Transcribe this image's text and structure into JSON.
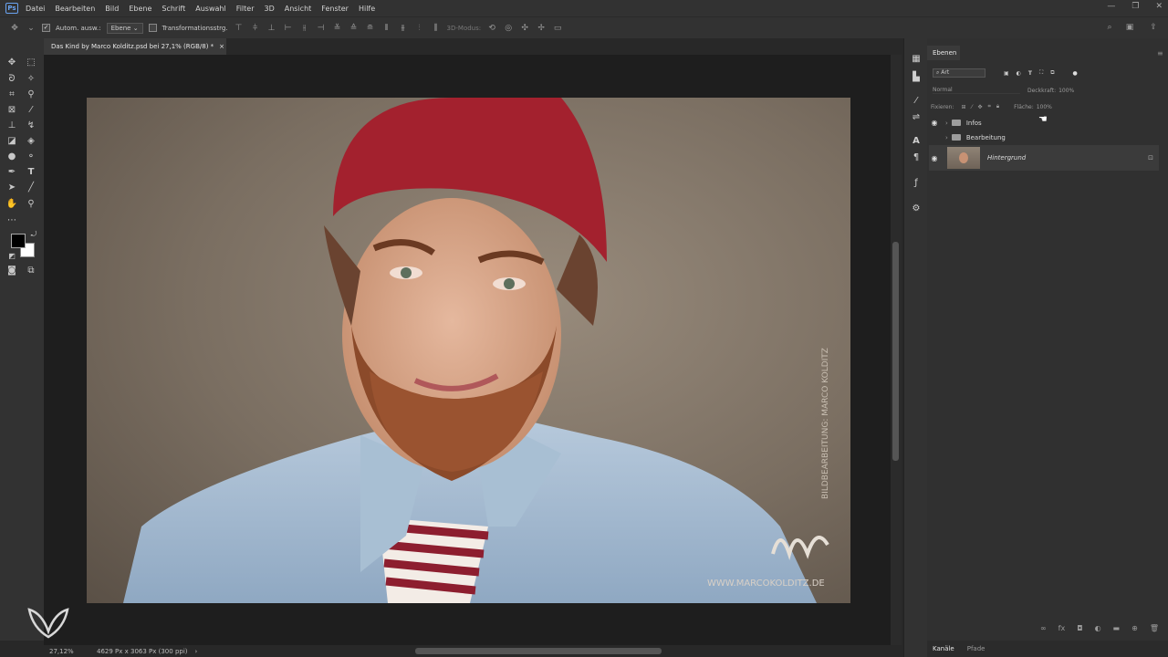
{
  "menubar": {
    "app_icon": "Ps",
    "items": [
      "Datei",
      "Bearbeiten",
      "Bild",
      "Ebene",
      "Schrift",
      "Auswahl",
      "Filter",
      "3D",
      "Ansicht",
      "Fenster",
      "Hilfe"
    ]
  },
  "window_controls": {
    "minimize": "—",
    "restore": "❐",
    "close": "✕"
  },
  "options": {
    "auto_select_label": "Autom. ausw.:",
    "auto_select_value": "Ebene",
    "transform_label": "Transformationsstrg.",
    "mode_3d": "3D-Modus:"
  },
  "document": {
    "tab_title": "Das Kind by Marco Kolditz.psd bei 27,1% (RGB/8) *",
    "close": "×",
    "watermark": "WWW.MARCOKOLDITZ.DE",
    "side_text": "BILDBEARBEITUNG: MARCO KOLDITZ"
  },
  "statusbar": {
    "zoom": "27,12%",
    "doc_size": "4629 Px x 3063 Px (300 ppi)"
  },
  "layers_panel": {
    "tab": "Ebenen",
    "filter": "Art",
    "blend_mode": "Normal",
    "opacity_label": "Deckkraft:",
    "opacity_value": "100%",
    "lock_label": "Fixieren:",
    "fill_label": "Fläche:",
    "fill_value": "100%",
    "layers": [
      {
        "name": "Infos",
        "type": "group",
        "visible": true
      },
      {
        "name": "Bearbeitung",
        "type": "group",
        "visible": false
      },
      {
        "name": "Hintergrund",
        "type": "pixel",
        "visible": true,
        "locked": true
      }
    ]
  },
  "bottom_tabs": [
    "Kanäle",
    "Pfade"
  ]
}
